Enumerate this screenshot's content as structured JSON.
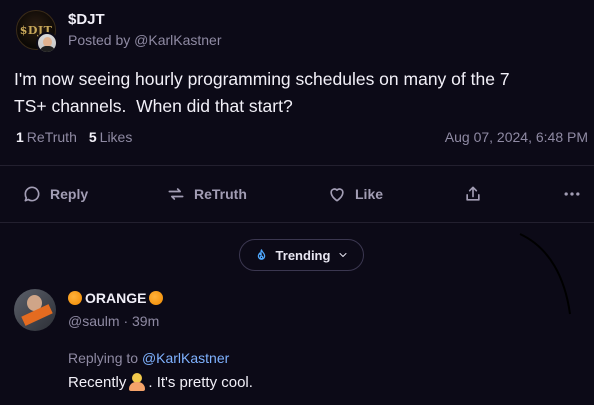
{
  "post": {
    "group_avatar_text": "$DJT",
    "group_name": "$DJT",
    "posted_by": "Posted by @KarlKastner",
    "body": "I'm now seeing hourly programming schedules on many of the 7\nTS+ channels.  When did that start?",
    "retruth_count": "1",
    "retruth_label": "ReTruth",
    "likes_count": "5",
    "likes_label": "Likes",
    "timestamp": "Aug 07, 2024, 6:48 PM"
  },
  "actions": {
    "reply": "Reply",
    "retruth": "ReTruth",
    "like": "Like"
  },
  "trending": {
    "label": "Trending",
    "accent": "#4ea8ff"
  },
  "reply": {
    "name": "ORANGE",
    "handle": "@saulm · 39m",
    "replying_prefix": "Replying to",
    "mention": "@KarlKastner",
    "text_before": "Recently",
    "text_after": ". It's pretty cool."
  },
  "icons": [
    "comment-icon",
    "retruth-icon",
    "heart-icon",
    "share-icon",
    "more-icon",
    "flame-icon",
    "chevron-down-icon"
  ]
}
